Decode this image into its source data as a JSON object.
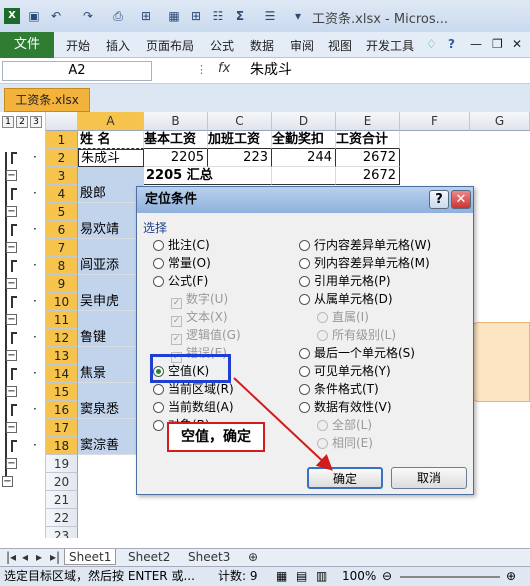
{
  "window": {
    "title": "工资条.xlsx - Micros..."
  },
  "ribbon": {
    "file_tab": "文件",
    "tabs": [
      "开始",
      "插入",
      "页面布局",
      "公式",
      "数据",
      "审阅",
      "视图",
      "开发工具"
    ]
  },
  "formula_bar": {
    "name_box": "A2",
    "fx": "fx",
    "value": "朱成斗"
  },
  "workbook": {
    "tab": "工资条.xlsx"
  },
  "outline": {
    "levels": [
      "1",
      "2",
      "3"
    ]
  },
  "columns": [
    "A",
    "B",
    "C",
    "D",
    "E",
    "F",
    "G"
  ],
  "rows": [
    "1",
    "2",
    "3",
    "4",
    "5",
    "6",
    "7",
    "8",
    "9",
    "10",
    "11",
    "12",
    "13",
    "14",
    "15",
    "16",
    "17",
    "18",
    "19",
    "20",
    "21",
    "22",
    "23"
  ],
  "cells": {
    "a1": "姓 名",
    "b1": "基本工资",
    "c1": "加班工资",
    "d1": "全勤奖扣",
    "e1": "工资合计",
    "a2": "朱成斗",
    "b2": "2205",
    "c2": "223",
    "d2": "244",
    "e2": "2672",
    "b3": "2205 汇总",
    "e3": "2672",
    "a4": "殷郎",
    "a6": "易欢靖",
    "a8": "闾亚添",
    "a10": "吴申虎",
    "a12": "鲁键",
    "a14": "焦景",
    "a16": "窦泉悉",
    "a18": "窦淙善"
  },
  "dialog": {
    "title": "定位条件",
    "help": "?",
    "close": "✕",
    "section": "选择",
    "left_options": [
      "批注(C)",
      "常量(O)",
      "公式(F)"
    ],
    "formula_checks": [
      "数字(U)",
      "文本(X)",
      "逻辑值(G)",
      "错误(E)"
    ],
    "blank_option": "空值(K)",
    "current_region": "当前区域(R)",
    "current_array": "当前数组(A)",
    "objects": "对象(B)",
    "right_options": [
      "行内容差异单元格(W)",
      "列内容差异单元格(M)",
      "引用单元格(P)",
      "从属单元格(D)"
    ],
    "dependents_sub": [
      "直属(I)",
      "所有级别(L)"
    ],
    "right_options2": [
      "最后一个单元格(S)",
      "可见单元格(Y)",
      "条件格式(T)",
      "数据有效性(V)"
    ],
    "validation_sub": [
      "全部(L)",
      "相同(E)"
    ],
    "ok": "确定",
    "cancel": "取消"
  },
  "annotation": "空值，确定",
  "sheets": [
    "Sheet1",
    "Sheet2",
    "Sheet3"
  ],
  "status": {
    "message": "选定目标区域，然后按 ENTER 或...",
    "count": "计数: 9",
    "zoom": "100%"
  },
  "colors": {
    "accent": "#2e7d32",
    "highlight": "#c2d3ec",
    "annotation_red": "#d21b1b",
    "selection_blue": "#1f3fd0"
  }
}
